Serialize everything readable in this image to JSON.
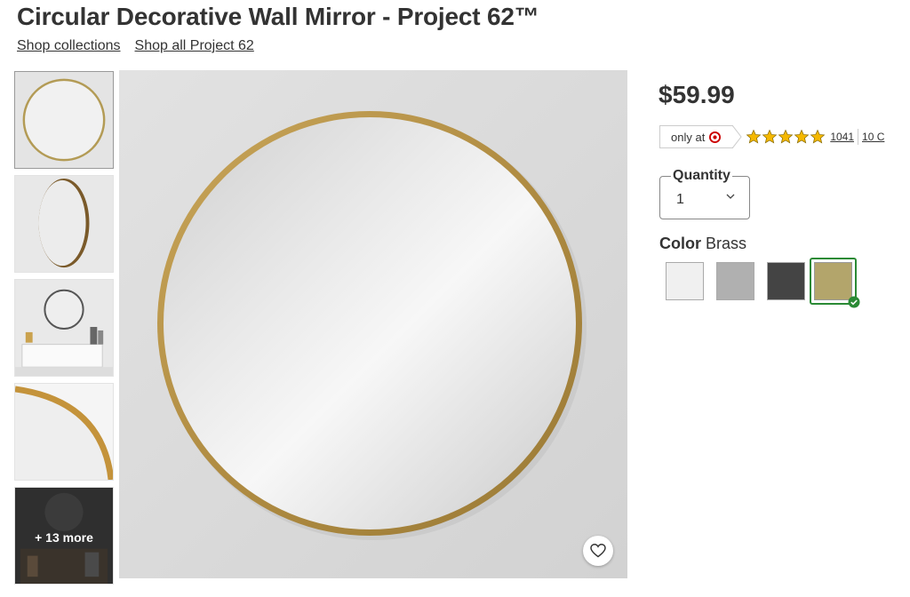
{
  "product": {
    "title": "Circular Decorative Wall Mirror - Project 62™",
    "price": "$59.99"
  },
  "breadcrumbs": [
    "Shop collections",
    "Shop all Project 62"
  ],
  "gallery": {
    "more_label": "+ 13 more"
  },
  "badge": {
    "only_at": "only at"
  },
  "rating": {
    "stars": 5,
    "count": "1041",
    "qa_label": "10 C"
  },
  "quantity": {
    "label": "Quantity",
    "value": "1"
  },
  "color": {
    "label": "Color",
    "selected": "Brass",
    "swatches": [
      {
        "name": "White",
        "hex": "#f0f0f0"
      },
      {
        "name": "Silver",
        "hex": "#b0b0b0"
      },
      {
        "name": "Black",
        "hex": "#444444"
      },
      {
        "name": "Brass",
        "hex": "#b3a56b",
        "selected": true
      }
    ]
  },
  "colors": {
    "accent_selected": "#2a8a35",
    "star": "#f5b800",
    "target_red": "#cc0000"
  }
}
